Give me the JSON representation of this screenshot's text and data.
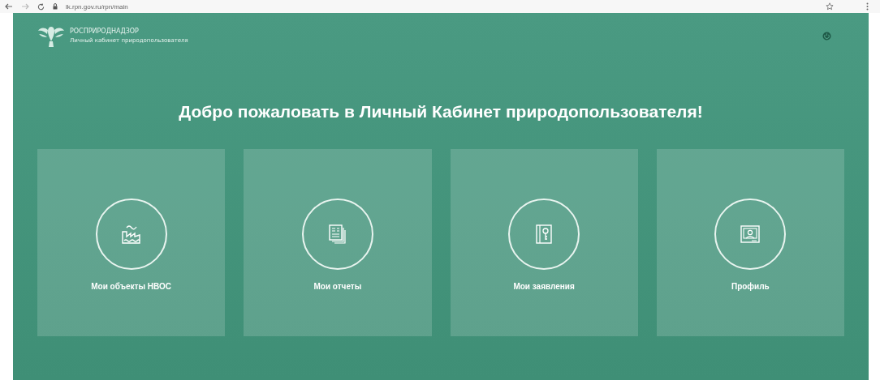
{
  "browser": {
    "url": "lk.rpn.gov.ru/rpn/main"
  },
  "header": {
    "brand": "РОСПРИРОДНАДЗОР",
    "subtitle": "Личный кабинет природопользователя"
  },
  "welcome": "Добро пожаловать в Личный Кабинет природопользователя!",
  "cards": [
    {
      "label": "Мои объекты НВОС"
    },
    {
      "label": "Мои отчеты"
    },
    {
      "label": "Мои заявления"
    },
    {
      "label": "Профиль"
    }
  ]
}
